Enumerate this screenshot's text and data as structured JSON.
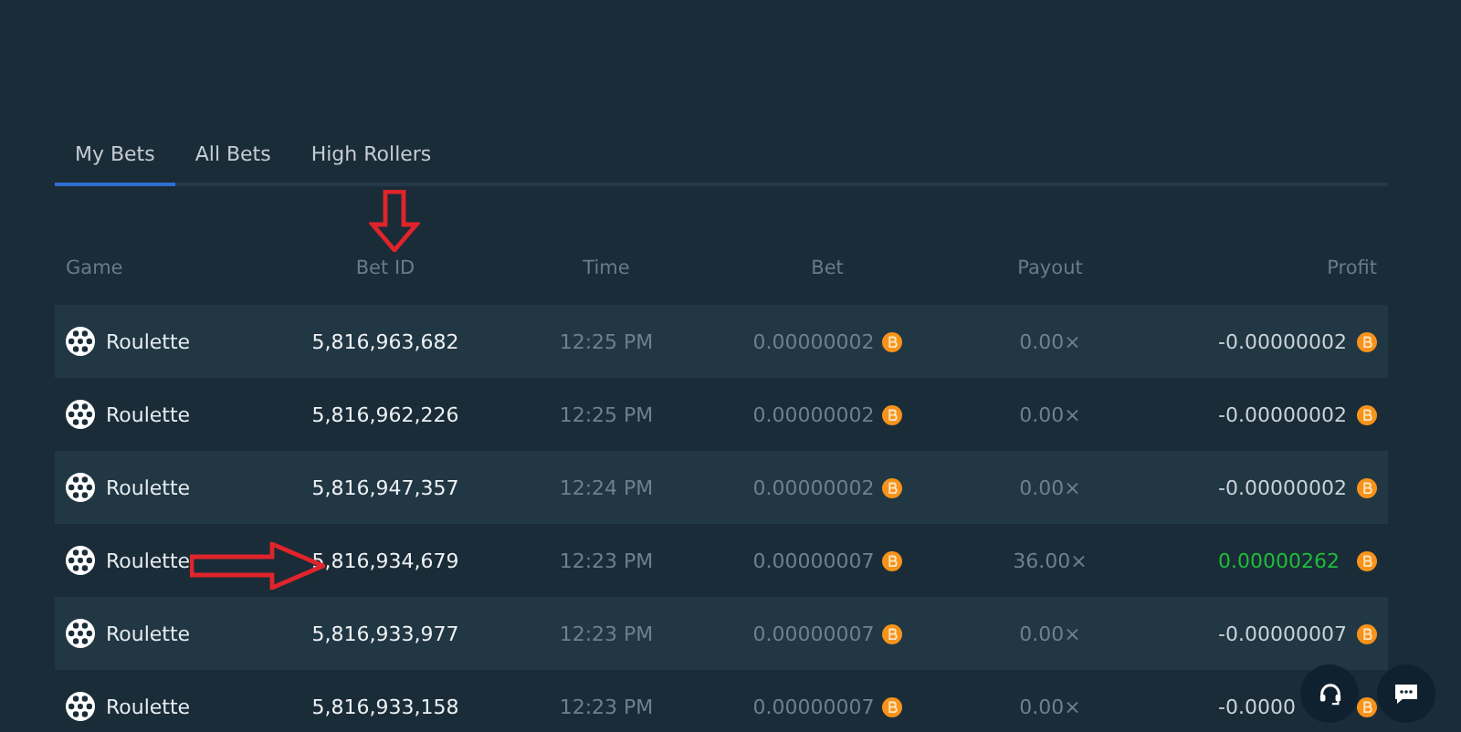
{
  "tabs": [
    {
      "label": "My Bets",
      "selected": true
    },
    {
      "label": "All Bets",
      "selected": false
    },
    {
      "label": "High Rollers",
      "selected": false
    }
  ],
  "table": {
    "columns": [
      "Game",
      "Bet ID",
      "Time",
      "Bet",
      "Payout",
      "Profit"
    ],
    "rows": [
      {
        "game": "Roulette",
        "bet_id": "5,816,963,682",
        "time": "12:25 PM",
        "bet": "0.00000002",
        "payout": "0.00×",
        "profit": "-0.00000002",
        "win": false
      },
      {
        "game": "Roulette",
        "bet_id": "5,816,962,226",
        "time": "12:25 PM",
        "bet": "0.00000002",
        "payout": "0.00×",
        "profit": "-0.00000002",
        "win": false
      },
      {
        "game": "Roulette",
        "bet_id": "5,816,947,357",
        "time": "12:24 PM",
        "bet": "0.00000002",
        "payout": "0.00×",
        "profit": "-0.00000002",
        "win": false
      },
      {
        "game": "Roulette",
        "bet_id": "5,816,934,679",
        "time": "12:23 PM",
        "bet": "0.00000007",
        "payout": "36.00×",
        "profit": "0.00000262",
        "win": true
      },
      {
        "game": "Roulette",
        "bet_id": "5,816,933,977",
        "time": "12:23 PM",
        "bet": "0.00000007",
        "payout": "0.00×",
        "profit": "-0.00000007",
        "win": false
      },
      {
        "game": "Roulette",
        "bet_id": "5,816,933,158",
        "time": "12:23 PM",
        "bet": "0.00000007",
        "payout": "0.00×",
        "profit": "-0.0000",
        "win": false
      }
    ]
  }
}
